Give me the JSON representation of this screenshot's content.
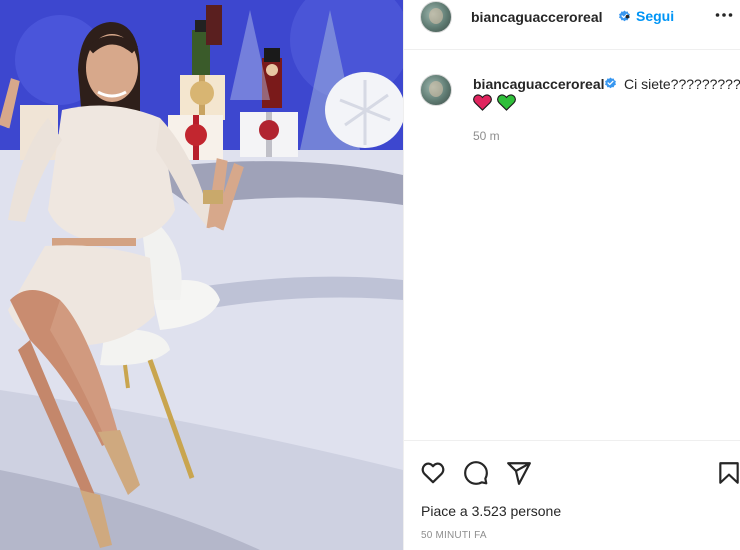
{
  "post": {
    "username": "biancaguaccero​real",
    "username_display": "biancaguacceroreal",
    "follow_label": "Segui",
    "separator": "•",
    "caption": "Ci siete??????????",
    "caption_emojis": [
      "red-heart",
      "green-heart"
    ],
    "time_ago": "50 m",
    "likes_text": "Piace a 3.523 persone",
    "post_date": "50 MINUTI FA"
  },
  "colors": {
    "link_blue": "#0095f6",
    "verified_blue": "#3897f0",
    "text_primary": "#262626",
    "text_secondary": "#8e8e8e",
    "heart_red": "#e0245e",
    "heart_green": "#2fbf3a"
  },
  "icons": {
    "more": "more-horizontal-icon",
    "like": "heart-outline-icon",
    "comment": "comment-bubble-icon",
    "share": "paper-plane-icon",
    "save": "bookmark-icon",
    "verified": "verified-badge-icon"
  }
}
